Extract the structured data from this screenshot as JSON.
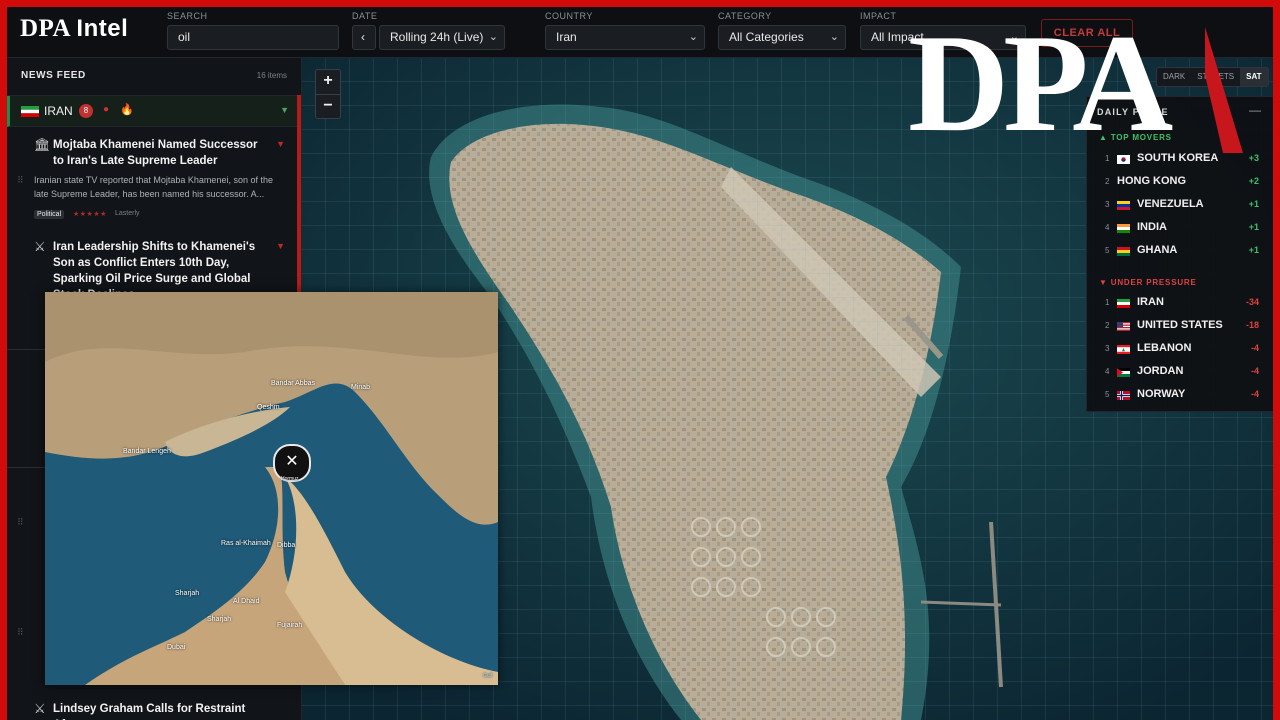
{
  "app": {
    "logo_main": "DPA",
    "logo_sub": "Intel"
  },
  "filters": {
    "search_label": "SEARCH",
    "search_value": "oil",
    "date_label": "DATE",
    "date_value": "Rolling 24h (Live)",
    "prev_label": "‹",
    "country_label": "COUNTRY",
    "country_value": "Iran",
    "category_label": "CATEGORY",
    "category_value": "All Categories",
    "impact_label": "IMPACT",
    "impact_value": "All Impact",
    "clear_label": "CLEAR ALL"
  },
  "sidebar": {
    "title": "NEWS FEED",
    "count": "16 items",
    "group": {
      "name": "IRAN",
      "badge": "8"
    },
    "items": [
      {
        "title": "Mojtaba Khamenei Named Successor to Iran's Late Supreme Leader",
        "body": "Iranian state TV reported that Mojtaba Khamenei, son of the late Supreme Leader, has been named his successor. A...",
        "tag": "Political",
        "stars": "★★★★★",
        "source": "Lasterly"
      },
      {
        "title": "Iran Leadership Shifts to Khamenei's Son as Conflict Enters 10th Day, Sparking Oil Price Surge and Global Stock Declines"
      },
      {
        "title": "Lindsey Graham Calls for Restraint After"
      }
    ]
  },
  "map": {
    "zoom_in": "+",
    "zoom_out": "−",
    "layers": [
      "DARK",
      "STREETS",
      "SAT"
    ],
    "active_layer": "SAT",
    "attribution": "Gulf"
  },
  "pulse": {
    "title": "DAILY PULSE",
    "min": "—",
    "top_label": "▲ TOP MOVERS",
    "top": [
      {
        "rank": "1",
        "country": "SOUTH KOREA",
        "delta": "+3"
      },
      {
        "rank": "2",
        "country": "HONG KONG",
        "delta": "+2"
      },
      {
        "rank": "3",
        "country": "VENEZUELA",
        "delta": "+1"
      },
      {
        "rank": "4",
        "country": "INDIA",
        "delta": "+1"
      },
      {
        "rank": "5",
        "country": "GHANA",
        "delta": "+1"
      }
    ],
    "under_label": "▼ UNDER PRESSURE",
    "under": [
      {
        "rank": "1",
        "country": "IRAN",
        "delta": "-34"
      },
      {
        "rank": "2",
        "country": "UNITED STATES",
        "delta": "-18"
      },
      {
        "rank": "3",
        "country": "LEBANON",
        "delta": "-4"
      },
      {
        "rank": "4",
        "country": "JORDAN",
        "delta": "-4"
      },
      {
        "rank": "5",
        "country": "NORWAY",
        "delta": "-4"
      }
    ]
  },
  "inset": {
    "labels": [
      "Bandar Abbas",
      "Qeshm",
      "Minab",
      "Bandar Lengeh",
      "Ras al-Khaimah",
      "Dibba",
      "Sharjah",
      "Al Dhaid",
      "Fujairah",
      "Sharjah",
      "Dubai"
    ],
    "marker_glyph": "✕",
    "marker_label": "Hormuz"
  },
  "watermark": "DPA"
}
